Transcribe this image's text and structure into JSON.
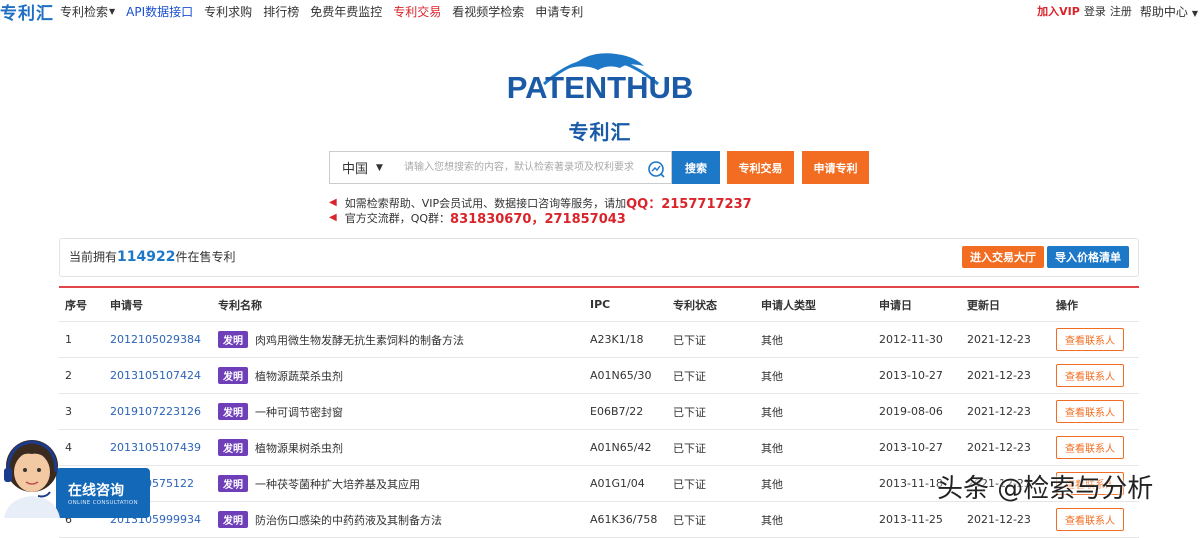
{
  "nav": {
    "brand": "专利汇",
    "items": [
      {
        "label": "专利检索",
        "dropdown": true,
        "color": "normal"
      },
      {
        "label": "API数据接口",
        "dropdown": false,
        "color": "blue"
      },
      {
        "label": "专利求购",
        "dropdown": false,
        "color": "normal"
      },
      {
        "label": "排行榜",
        "dropdown": false,
        "color": "normal"
      },
      {
        "label": "免费年费监控",
        "dropdown": false,
        "color": "normal"
      },
      {
        "label": "专利交易",
        "dropdown": false,
        "color": "red"
      },
      {
        "label": "看视频学检索",
        "dropdown": false,
        "color": "normal"
      },
      {
        "label": "申请专利",
        "dropdown": false,
        "color": "normal"
      }
    ],
    "right": {
      "vip": "加入VIP",
      "login": "登录",
      "register": "注册",
      "help": "帮助中心"
    }
  },
  "logo": {
    "text": "PATENTHUB",
    "cn": "专利汇"
  },
  "search": {
    "region": "中国",
    "placeholder": "请输入您想搜索的内容，默认检索著录项及权利要求",
    "search_label": "搜索",
    "trade_label": "专利交易",
    "apply_label": "申请专利"
  },
  "notices": {
    "n1_text": "如需检索帮助、VIP会员试用、数据接口咨询等服务，请加",
    "n1_highlight": "QQ：2157717237",
    "n2_text": "官方交流群，QQ群：",
    "n2_highlight": "831830670，271857043"
  },
  "summary": {
    "prefix": "当前拥有",
    "count": "114922",
    "suffix": "件在售专利",
    "hall_label": "进入交易大厅",
    "import_label": "导入价格清单"
  },
  "table": {
    "headers": {
      "idx": "序号",
      "app": "申请号",
      "name": "专利名称",
      "ipc": "IPC",
      "status": "专利状态",
      "type": "申请人类型",
      "date": "申请日",
      "upd": "更新日",
      "op": "操作"
    },
    "rows": [
      {
        "idx": "1",
        "app": "2012105029384",
        "badge": "发明",
        "name": "肉鸡用微生物发酵无抗生素饲料的制备方法",
        "ipc": "A23K1/18",
        "status": "已下证",
        "type": "其他",
        "date": "2012-11-30",
        "upd": "2021-12-23",
        "op": "查看联系人"
      },
      {
        "idx": "2",
        "app": "2013105107424",
        "badge": "发明",
        "name": "植物源蔬菜杀虫剂",
        "ipc": "A01N65/30",
        "status": "已下证",
        "type": "其他",
        "date": "2013-10-27",
        "upd": "2021-12-23",
        "op": "查看联系人"
      },
      {
        "idx": "3",
        "app": "2019107223126",
        "badge": "发明",
        "name": "一种可调节密封窗",
        "ipc": "E06B7/22",
        "status": "已下证",
        "type": "其他",
        "date": "2019-08-06",
        "upd": "2021-12-23",
        "op": "查看联系人"
      },
      {
        "idx": "4",
        "app": "2013105107439",
        "badge": "发明",
        "name": "植物源果树杀虫剂",
        "ipc": "A01N65/42",
        "status": "已下证",
        "type": "其他",
        "date": "2013-10-27",
        "upd": "2021-12-23",
        "op": "查看联系人"
      },
      {
        "idx": "5",
        "app": "201310575122",
        "badge": "发明",
        "name": "一种茯苓菌种扩大培养基及其应用",
        "ipc": "A01G1/04",
        "status": "已下证",
        "type": "其他",
        "date": "2013-11-18",
        "upd": "2021-12-23",
        "op": "查看联系人"
      },
      {
        "idx": "6",
        "app": "2013105999934",
        "badge": "发明",
        "name": "防治伤口感染的中药药液及其制备方法",
        "ipc": "A61K36/758",
        "status": "已下证",
        "type": "其他",
        "date": "2013-11-25",
        "upd": "2021-12-23",
        "op": "查看联系人"
      }
    ]
  },
  "consult": {
    "title": "在线咨询",
    "subtitle": "ONLINE CONSULTATION"
  },
  "watermark": "头条 @检索与分析",
  "colors": {
    "primary_blue": "#1e78c8",
    "accent_orange": "#f26d21",
    "red": "#d9242b",
    "badge_purple": "#6e3fb8"
  }
}
